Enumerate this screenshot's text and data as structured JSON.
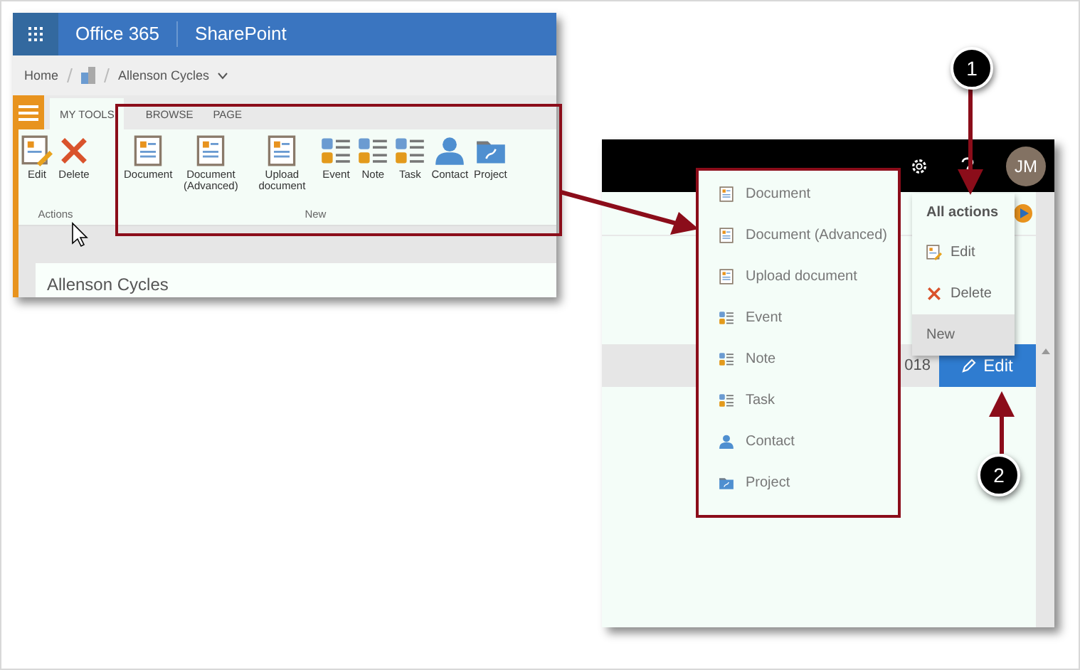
{
  "sharepoint_window": {
    "suite_name": "Office 365",
    "app_name": "SharePoint",
    "breadcrumb": [
      "Home",
      "Allenson Cycles"
    ],
    "tabs": [
      {
        "label": "MY TOOLS",
        "selected": true
      },
      {
        "label": "BROWSE",
        "selected": false
      },
      {
        "label": "PAGE",
        "selected": false
      }
    ],
    "ribbon_groups": [
      {
        "label": "Actions",
        "buttons": [
          {
            "label": "Edit",
            "kind": "edit"
          },
          {
            "label": "Delete",
            "kind": "delete"
          }
        ]
      },
      {
        "label": "New",
        "buttons": [
          {
            "label": "Document",
            "kind": "document"
          },
          {
            "label": "Document (Advanced)",
            "kind": "document"
          },
          {
            "label": "Upload document",
            "kind": "document"
          },
          {
            "label": "Event",
            "kind": "list"
          },
          {
            "label": "Note",
            "kind": "list"
          },
          {
            "label": "Task",
            "kind": "list"
          },
          {
            "label": "Contact",
            "kind": "contact"
          },
          {
            "label": "Project",
            "kind": "project"
          }
        ]
      }
    ],
    "page_title": "Allenson Cycles"
  },
  "modern_window": {
    "avatar_initials": "JM",
    "actions_menu": {
      "title": "All actions",
      "items": [
        {
          "label": "Edit",
          "kind": "edit",
          "selected": false
        },
        {
          "label": "Delete",
          "kind": "delete",
          "selected": false
        },
        {
          "label": "New",
          "kind": "submenu",
          "selected": true
        }
      ]
    },
    "new_menu": [
      {
        "label": "Document",
        "kind": "document"
      },
      {
        "label": "Document (Advanced)",
        "kind": "document"
      },
      {
        "label": "Upload document",
        "kind": "document"
      },
      {
        "label": "Event",
        "kind": "list"
      },
      {
        "label": "Note",
        "kind": "list"
      },
      {
        "label": "Task",
        "kind": "list"
      },
      {
        "label": "Contact",
        "kind": "contact"
      },
      {
        "label": "Project",
        "kind": "project"
      }
    ],
    "row_text": "018",
    "edit_button": "Edit"
  },
  "callouts": [
    {
      "label": "1"
    },
    {
      "label": "2"
    }
  ]
}
